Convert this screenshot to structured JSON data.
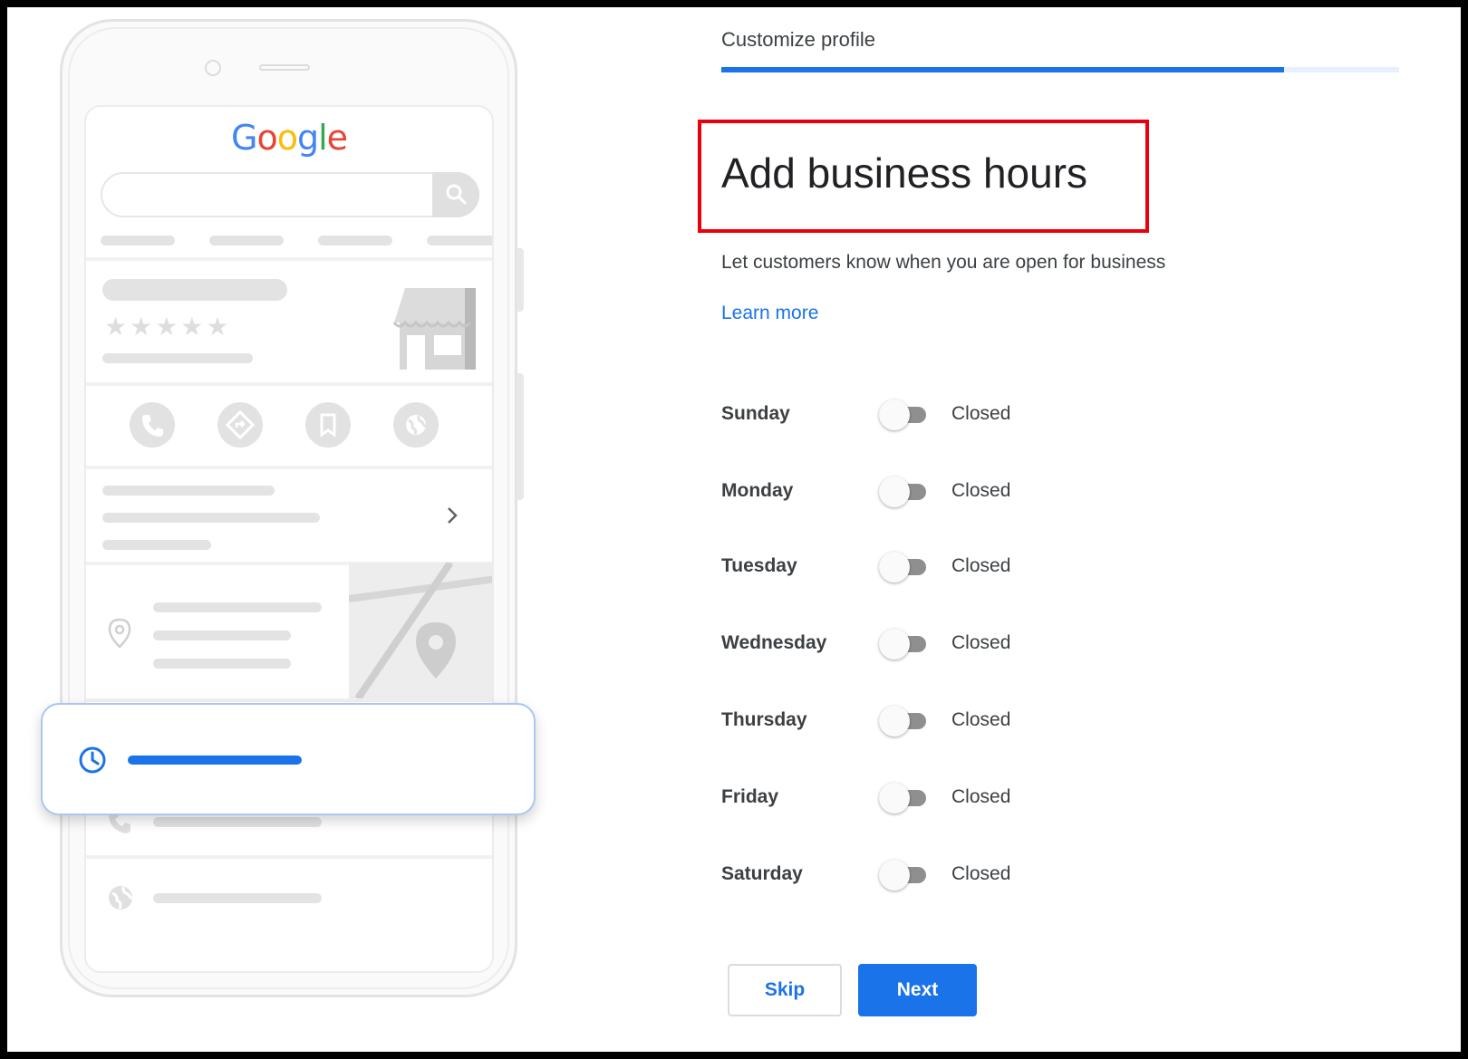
{
  "step": {
    "title": "Customize profile",
    "progress_fraction": 0.83
  },
  "heading": {
    "title": "Add business hours",
    "subtitle": "Let customers know when you are open for business",
    "learn_more": "Learn more"
  },
  "preview": {
    "logo_letters": [
      "G",
      "o",
      "o",
      "g",
      "l",
      "e"
    ],
    "logo_colors": [
      "#4285f4",
      "#ea4335",
      "#fbbc05",
      "#4285f4",
      "#34a853",
      "#ea4335"
    ],
    "stars": "★★★★★",
    "accent": "#1a73e8"
  },
  "days": [
    {
      "name": "Sunday",
      "status": "Closed"
    },
    {
      "name": "Monday",
      "status": "Closed"
    },
    {
      "name": "Tuesday",
      "status": "Closed"
    },
    {
      "name": "Wednesday",
      "status": "Closed"
    },
    {
      "name": "Thursday",
      "status": "Closed"
    },
    {
      "name": "Friday",
      "status": "Closed"
    },
    {
      "name": "Saturday",
      "status": "Closed"
    }
  ],
  "actions": {
    "skip": "Skip",
    "next": "Next"
  }
}
